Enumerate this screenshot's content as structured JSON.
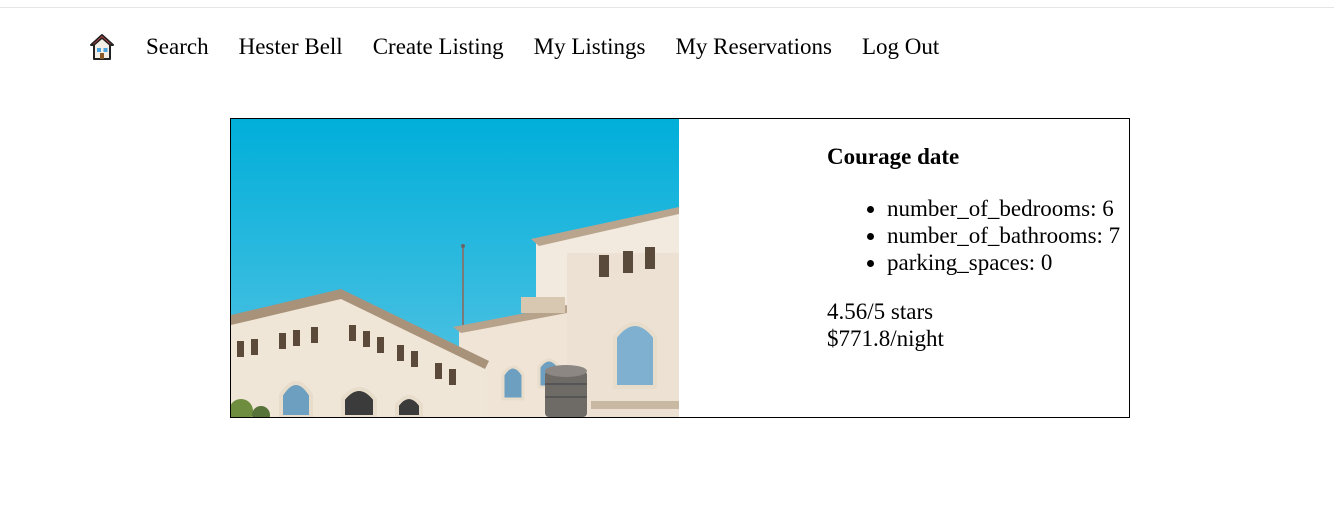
{
  "nav": {
    "home_icon": "house-icon",
    "items": [
      {
        "label": "Search"
      },
      {
        "label": "Hester Bell"
      },
      {
        "label": "Create Listing"
      },
      {
        "label": "My Listings"
      },
      {
        "label": "My Reservations"
      },
      {
        "label": "Log Out"
      }
    ]
  },
  "listing": {
    "title": "Courage date",
    "features": [
      "number_of_bedrooms: 6",
      "number_of_bathrooms: 7",
      "parking_spaces: 0"
    ],
    "rating": "4.56/5 stars",
    "price": "$771.8/night"
  },
  "colors": {
    "sky": "#03b1dc",
    "building": "#efe4d6",
    "border": "#000000"
  }
}
